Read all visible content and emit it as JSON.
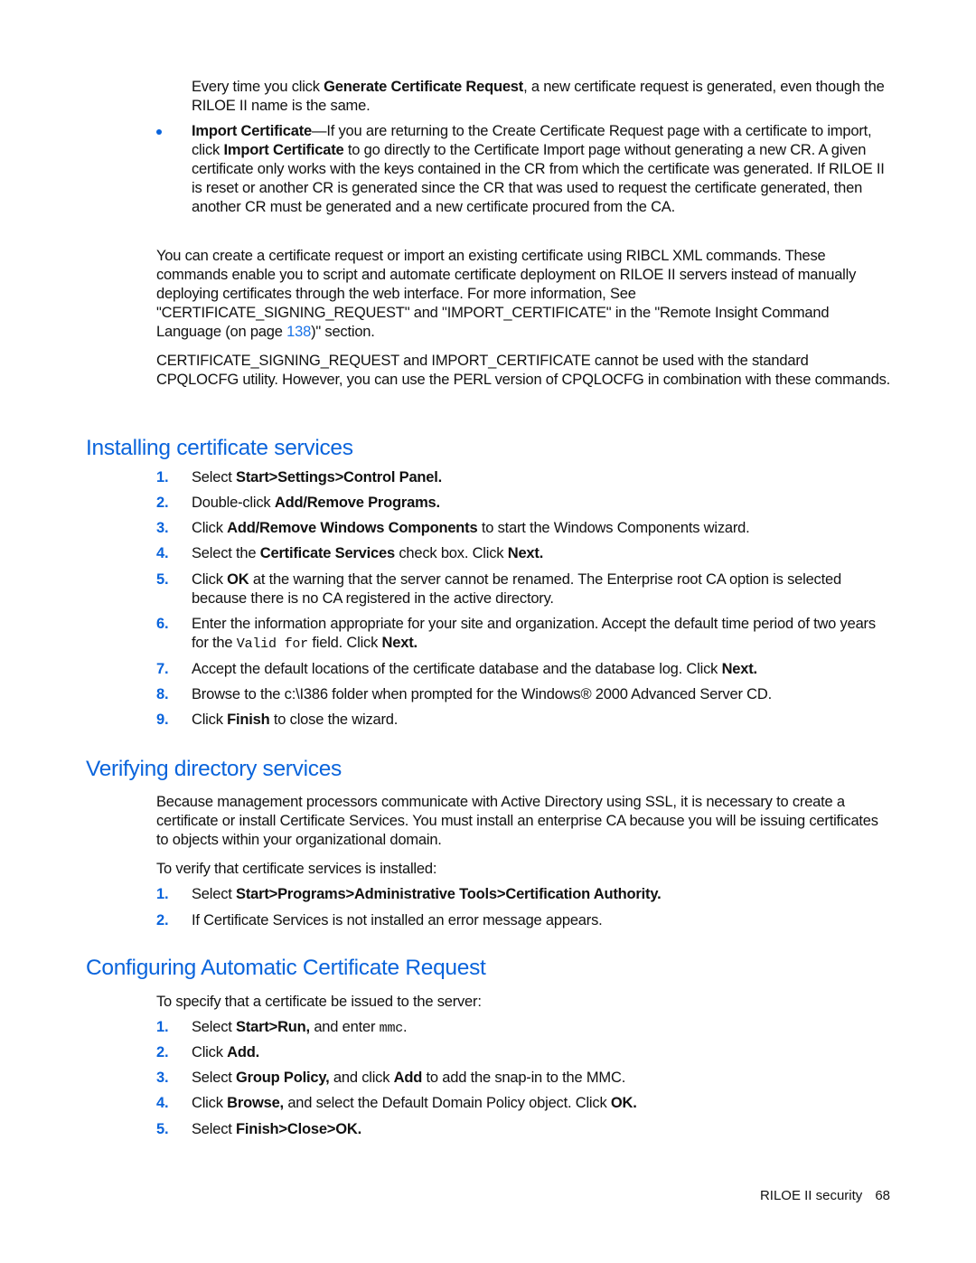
{
  "intro": {
    "continuation": {
      "parts": [
        {
          "t": "Every time you click ",
          "s": "n"
        },
        {
          "t": "Generate Certificate Request",
          "s": "b"
        },
        {
          "t": ", a new certificate request is generated, even though the RILOE II name is the same.",
          "s": "n"
        }
      ]
    },
    "bullet_import": {
      "parts": [
        {
          "t": "Import Certificate",
          "s": "b"
        },
        {
          "t": "—If you are returning to the Create Certificate Request page with a certificate to import, click ",
          "s": "n"
        },
        {
          "t": "Import Certificate",
          "s": "b"
        },
        {
          "t": " to go directly to the Certificate Import page without generating a new CR. A given certificate only works with the keys contained in the CR from which the certificate was generated. If RILOE II is reset or another CR is generated since the CR that was used to request the certificate generated, then another CR must be generated and a new certificate procured from the CA.",
          "s": "n"
        }
      ]
    },
    "para_ribcl": {
      "parts": [
        {
          "t": "You can create a certificate request or import an existing certificate using RIBCL XML commands. These commands enable you to script and automate certificate deployment on RILOE II servers instead of manually deploying certificates through the web interface. For more information, See \"CERTIFICATE_SIGNING_REQUEST\" and \"IMPORT_CERTIFICATE\" in the \"Remote Insight Command Language (on page ",
          "s": "n"
        },
        {
          "t": "138",
          "s": "link"
        },
        {
          "t": ")\" section.",
          "s": "n"
        }
      ]
    },
    "para_cpqlocfg": {
      "parts": [
        {
          "t": "CERTIFICATE_SIGNING_REQUEST and IMPORT_CERTIFICATE cannot be used with the standard CPQLOCFG utility. However, you can use the PERL version of CPQLOCFG in combination with these commands.",
          "s": "n"
        }
      ]
    }
  },
  "sections": [
    {
      "title": "Installing certificate services",
      "steps": [
        {
          "num": "1.",
          "parts": [
            {
              "t": "Select ",
              "s": "n"
            },
            {
              "t": "Start>Settings>Control Panel.",
              "s": "b"
            }
          ]
        },
        {
          "num": "2.",
          "parts": [
            {
              "t": "Double-click ",
              "s": "n"
            },
            {
              "t": "Add/Remove Programs.",
              "s": "b"
            }
          ]
        },
        {
          "num": "3.",
          "parts": [
            {
              "t": "Click ",
              "s": "n"
            },
            {
              "t": "Add/Remove Windows Components",
              "s": "b"
            },
            {
              "t": " to start the Windows Components wizard.",
              "s": "n"
            }
          ]
        },
        {
          "num": "4.",
          "parts": [
            {
              "t": "Select the ",
              "s": "n"
            },
            {
              "t": "Certificate Services",
              "s": "b"
            },
            {
              "t": " check box. Click ",
              "s": "n"
            },
            {
              "t": "Next.",
              "s": "b"
            }
          ]
        },
        {
          "num": "5.",
          "parts": [
            {
              "t": "Click ",
              "s": "n"
            },
            {
              "t": "OK",
              "s": "b"
            },
            {
              "t": " at the warning that the server cannot be renamed. The Enterprise root CA option is selected because there is no CA registered in the active directory.",
              "s": "n"
            }
          ]
        },
        {
          "num": "6.",
          "parts": [
            {
              "t": "Enter the information appropriate for your site and organization. Accept the default time period of two years for the ",
              "s": "n"
            },
            {
              "t": "Valid for",
              "s": "mono"
            },
            {
              "t": " field. Click ",
              "s": "n"
            },
            {
              "t": "Next.",
              "s": "b"
            }
          ]
        },
        {
          "num": "7.",
          "parts": [
            {
              "t": "Accept the default locations of the certificate database and the database log. Click ",
              "s": "n"
            },
            {
              "t": "Next.",
              "s": "b"
            }
          ]
        },
        {
          "num": "8.",
          "parts": [
            {
              "t": "Browse to the c:\\I386 folder when prompted for the Windows® 2000 Advanced Server CD.",
              "s": "n"
            }
          ]
        },
        {
          "num": "9.",
          "parts": [
            {
              "t": "Click ",
              "s": "n"
            },
            {
              "t": "Finish",
              "s": "b"
            },
            {
              "t": " to close the wizard.",
              "s": "n"
            }
          ]
        }
      ]
    },
    {
      "title": "Verifying directory services",
      "paragraphs": [
        "Because management processors communicate with Active Directory using SSL, it is necessary to create a certificate or install Certificate Services. You must install an enterprise CA because you will be issuing certificates to objects within your organizational domain.",
        "To verify that certificate services is installed:"
      ],
      "steps": [
        {
          "num": "1.",
          "parts": [
            {
              "t": "Select ",
              "s": "n"
            },
            {
              "t": "Start>Programs>Administrative Tools>Certification Authority.",
              "s": "b"
            }
          ]
        },
        {
          "num": "2.",
          "parts": [
            {
              "t": "If Certificate Services is not installed an error message appears.",
              "s": "n"
            }
          ]
        }
      ]
    },
    {
      "title": "Configuring Automatic Certificate Request",
      "paragraphs": [
        "To specify that a certificate be issued to the server:"
      ],
      "steps": [
        {
          "num": "1.",
          "parts": [
            {
              "t": "Select ",
              "s": "n"
            },
            {
              "t": "Start>Run,",
              "s": "b"
            },
            {
              "t": " and enter ",
              "s": "n"
            },
            {
              "t": "mmc",
              "s": "mono"
            },
            {
              "t": ".",
              "s": "n"
            }
          ]
        },
        {
          "num": "2.",
          "parts": [
            {
              "t": "Click ",
              "s": "n"
            },
            {
              "t": "Add.",
              "s": "b"
            }
          ]
        },
        {
          "num": "3.",
          "parts": [
            {
              "t": "Select ",
              "s": "n"
            },
            {
              "t": "Group Policy,",
              "s": "b"
            },
            {
              "t": " and click ",
              "s": "n"
            },
            {
              "t": "Add",
              "s": "b"
            },
            {
              "t": " to add the snap-in to the MMC.",
              "s": "n"
            }
          ]
        },
        {
          "num": "4.",
          "parts": [
            {
              "t": "Click ",
              "s": "n"
            },
            {
              "t": "Browse,",
              "s": "b"
            },
            {
              "t": " and select the Default Domain Policy object. Click ",
              "s": "n"
            },
            {
              "t": "OK.",
              "s": "b"
            }
          ]
        },
        {
          "num": "5.",
          "parts": [
            {
              "t": "Select ",
              "s": "n"
            },
            {
              "t": "Finish>Close>OK.",
              "s": "b"
            }
          ]
        }
      ]
    }
  ],
  "footer": {
    "section_label": "RILOE II security",
    "page_number": "68"
  },
  "colors": {
    "accent": "#0a64dc",
    "link": "#1a73e8",
    "text": "#111111"
  }
}
